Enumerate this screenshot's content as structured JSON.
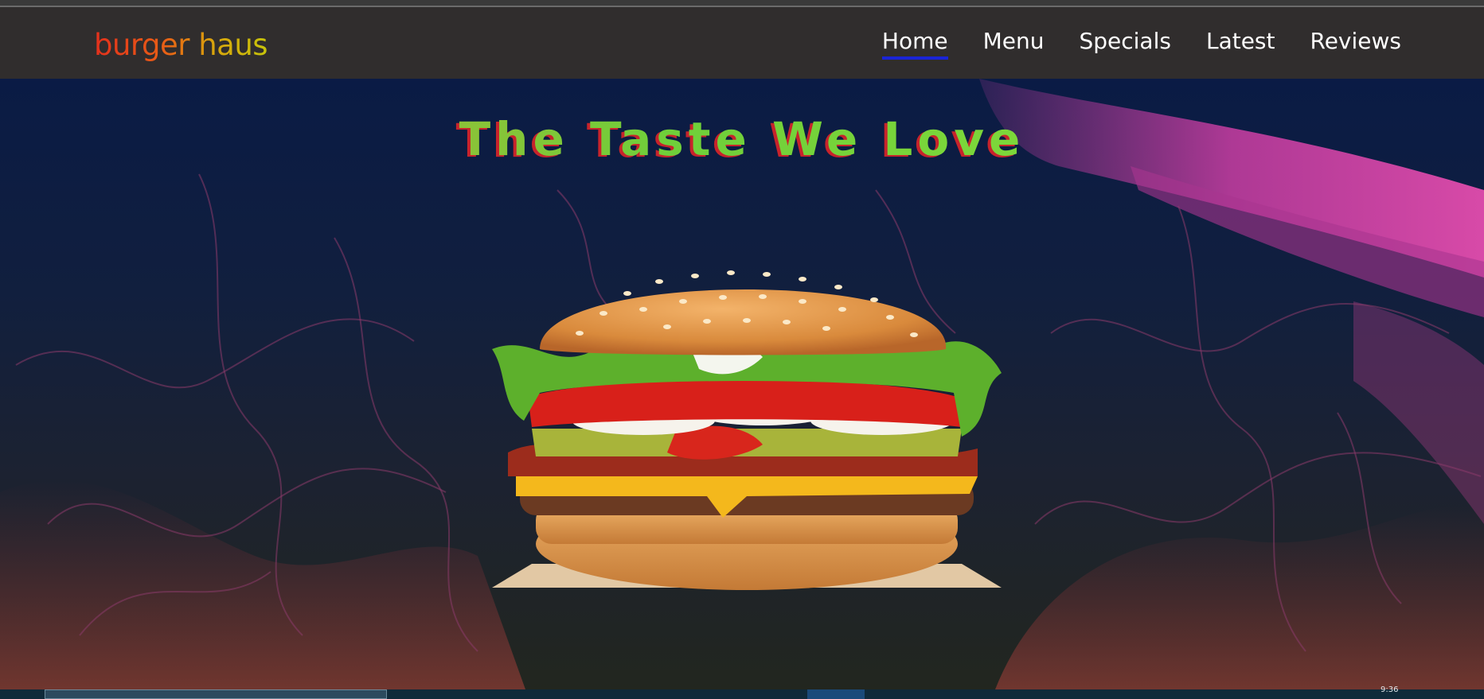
{
  "brand": {
    "name": "burger haus"
  },
  "nav": {
    "items": [
      {
        "label": "Home",
        "active": true
      },
      {
        "label": "Menu",
        "active": false
      },
      {
        "label": "Specials",
        "active": false
      },
      {
        "label": "Latest",
        "active": false
      },
      {
        "label": "Reviews",
        "active": false
      }
    ]
  },
  "hero": {
    "title": "The Taste We Love",
    "image": "burger-image"
  },
  "taskbar": {
    "clock": "9:36"
  },
  "colors": {
    "navbar_bg": "#302d2d",
    "active_underline": "#1a24d6",
    "hero_top": "#0a1b45",
    "hero_bottom": "#22261f",
    "title_green": "#6fcf3a",
    "title_shadow": "#c8232b"
  }
}
